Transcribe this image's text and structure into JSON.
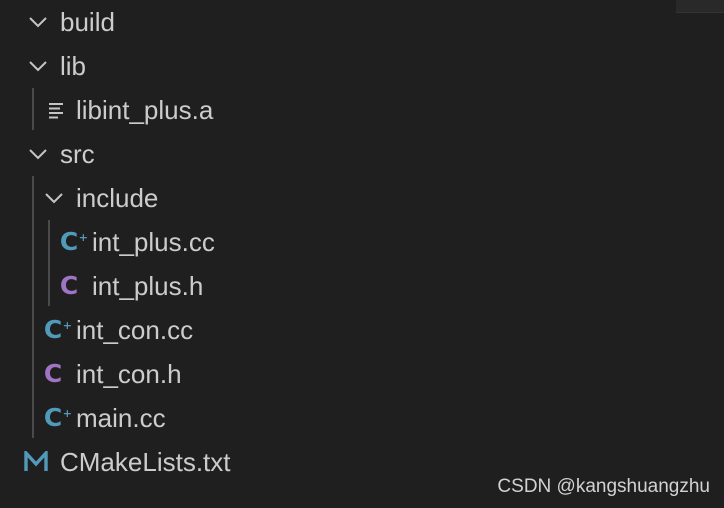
{
  "explorer": {
    "items": [
      {
        "label": "build",
        "kind": "folder",
        "expanded": true
      },
      {
        "label": "lib",
        "kind": "folder",
        "expanded": true
      },
      {
        "label": "libint_plus.a",
        "kind": "file",
        "icon": "lines-file-icon"
      },
      {
        "label": "src",
        "kind": "folder",
        "expanded": true
      },
      {
        "label": "include",
        "kind": "folder",
        "expanded": true
      },
      {
        "label": "int_plus.cc",
        "kind": "file",
        "icon": "cpp-file-icon"
      },
      {
        "label": "int_plus.h",
        "kind": "file",
        "icon": "c-header-file-icon"
      },
      {
        "label": "int_con.cc",
        "kind": "file",
        "icon": "cpp-file-icon"
      },
      {
        "label": "int_con.h",
        "kind": "file",
        "icon": "c-header-file-icon"
      },
      {
        "label": "main.cc",
        "kind": "file",
        "icon": "cpp-file-icon"
      },
      {
        "label": "CMakeLists.txt",
        "kind": "file",
        "icon": "cmake-file-icon"
      }
    ]
  },
  "icons": {
    "cpp": {
      "glyph": "C",
      "suffix": "+",
      "color": "#519aba"
    },
    "header": {
      "glyph": "C",
      "color": "#a074c4"
    },
    "cmake": {
      "color": "#519aba"
    }
  },
  "colors": {
    "background": "#1f1f1f",
    "text": "#cccccc",
    "indent_guide": "#4a4a4a"
  },
  "watermark": {
    "text": "CSDN @kangshuangzhu"
  }
}
